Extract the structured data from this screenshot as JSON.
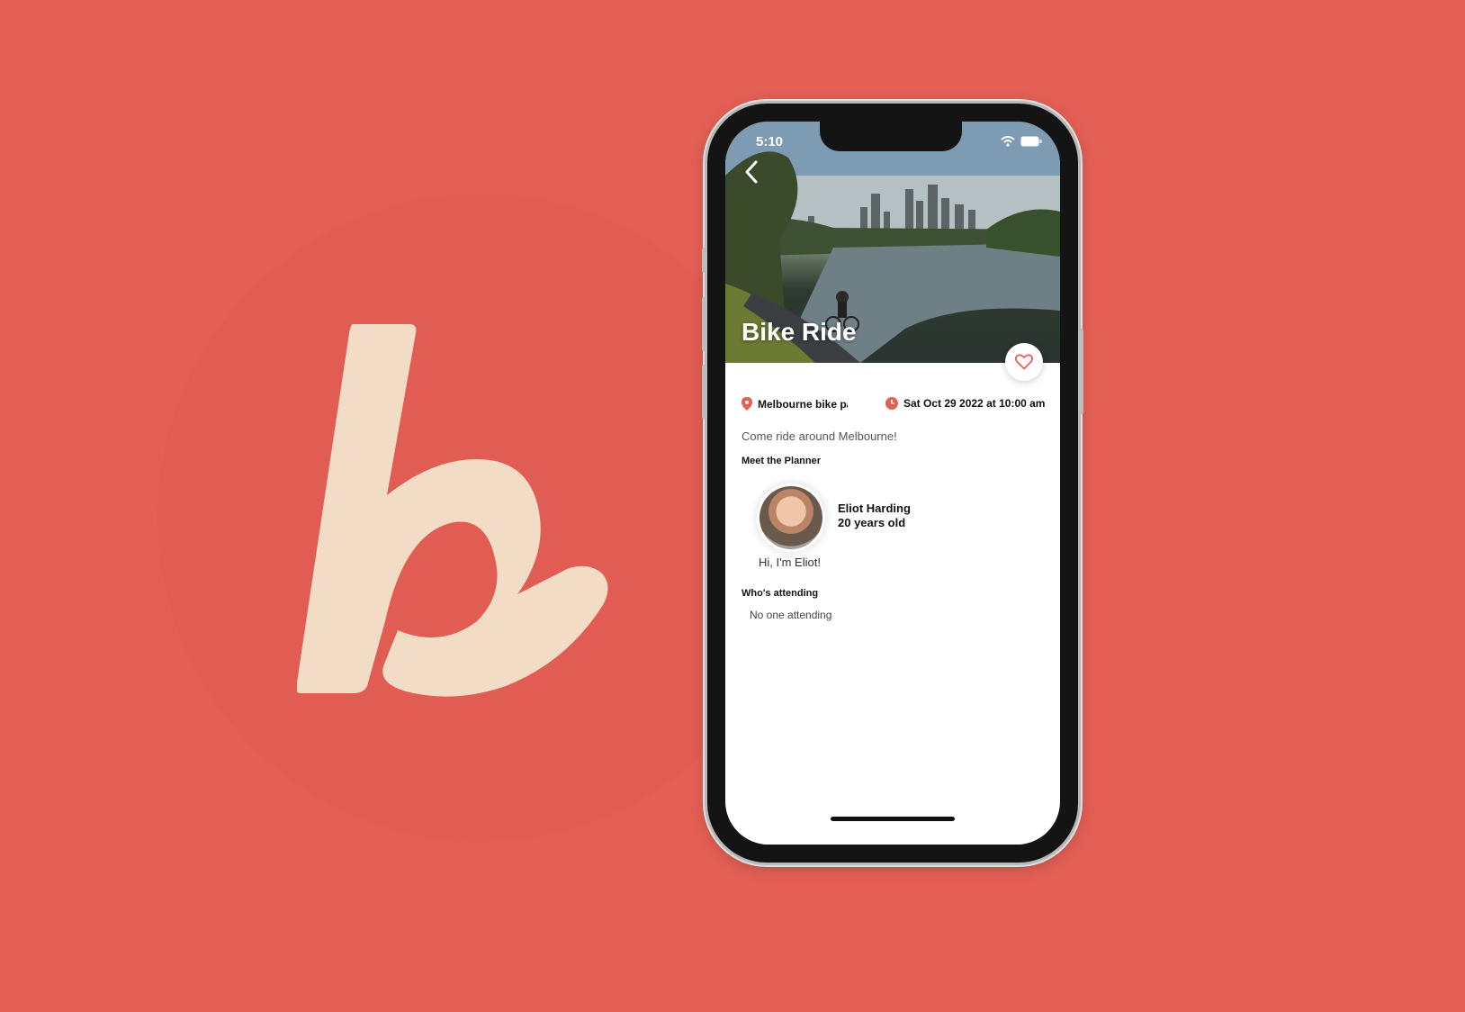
{
  "colors": {
    "background": "#e35f55",
    "logo": "#f2dcc6",
    "accent": "#e35f55"
  },
  "status_bar": {
    "time": "5:10"
  },
  "event": {
    "title": "Bike Ride",
    "location": "Melbourne bike path",
    "date": "Sat Oct 29 2022",
    "at_label": "at",
    "time": "10:00 am",
    "description": "Come ride around Melbourne!"
  },
  "planner": {
    "section_title": "Meet the Planner",
    "name": "Eliot Harding",
    "age": "20 years old",
    "bio": "Hi, I'm Eliot!"
  },
  "attending": {
    "section_title": "Who's attending",
    "empty_text": "No one attending"
  },
  "icons": {
    "back": "chevron-left-icon",
    "favorite": "heart-icon",
    "location": "location-pin-icon",
    "time": "clock-icon"
  }
}
